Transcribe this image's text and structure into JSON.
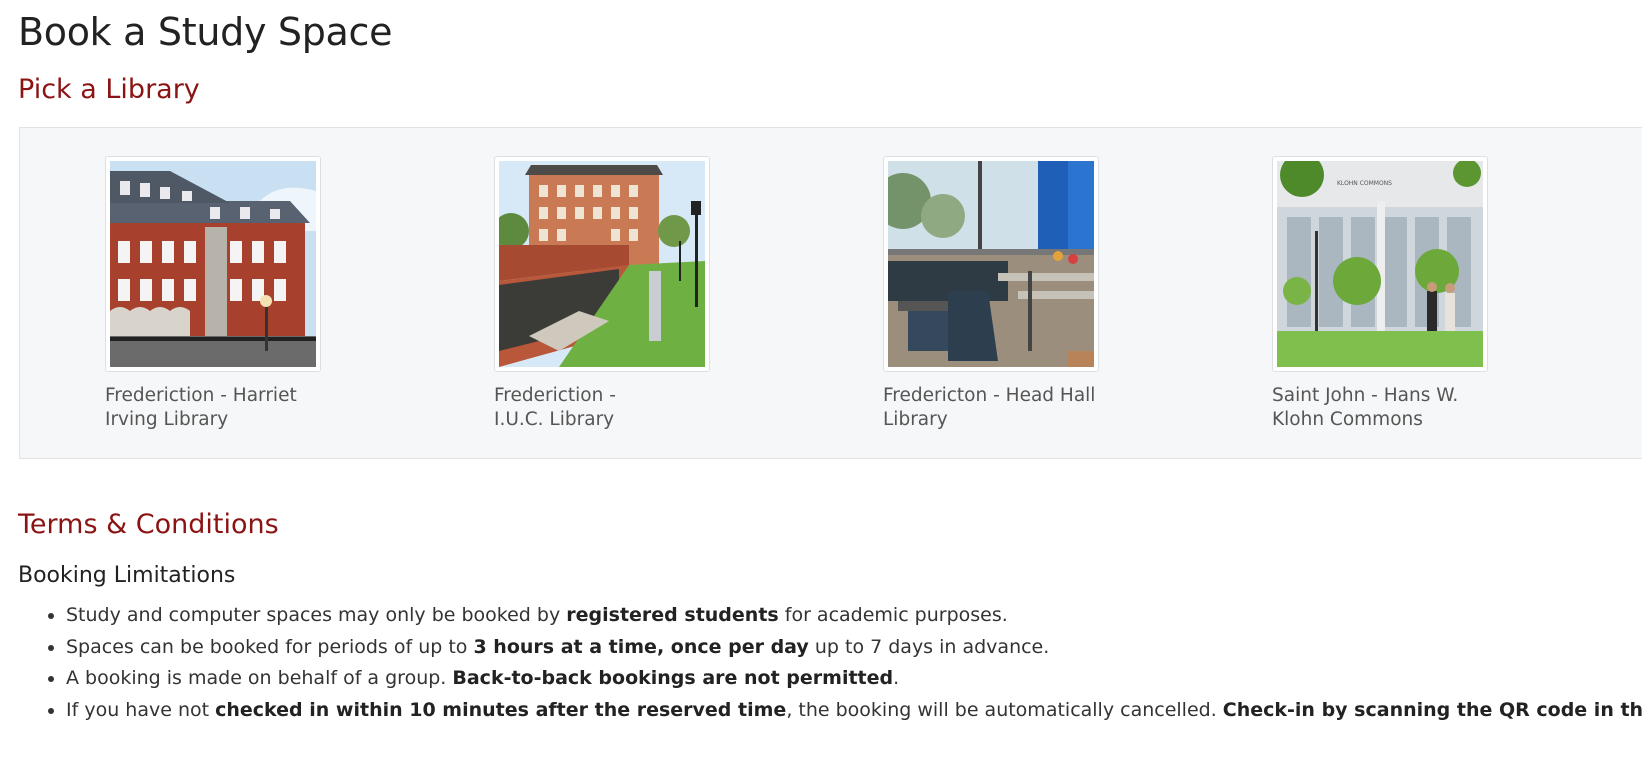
{
  "page": {
    "title": "Book a Study Space",
    "pick_heading": "Pick a Library",
    "terms_heading": "Terms & Conditions"
  },
  "libraries": [
    {
      "name": "Frederiction - Harriet Irving Library",
      "image": "harriet-irving-library-photo"
    },
    {
      "name": "Frederiction - I.U.C. Library",
      "image": "iuc-library-photo"
    },
    {
      "name": "Fredericton - Head Hall Library",
      "image": "head-hall-library-photo"
    },
    {
      "name": "Saint John - Hans W. Klohn Commons",
      "image": "klohn-commons-photo"
    }
  ],
  "terms": {
    "subheading": "Booking Limitations",
    "items": [
      {
        "p1": "Study and computer spaces may only be booked by ",
        "b1": "registered students",
        "p2": " for academic purposes."
      },
      {
        "p1": "Spaces can be booked for periods of up to ",
        "b1": "3 hours at a time, once per day",
        "p2": " up to 7 days in advance."
      },
      {
        "p1": "A booking is made on behalf of a group. ",
        "b1": "Back-to-back bookings are not permitted",
        "p2": "."
      },
      {
        "p1": "If you have not ",
        "b1": "checked in within 10 minutes after the reserved time",
        "p2": ", the booking will be automatically cancelled. ",
        "b2": "Check-in by scanning the QR code in the room"
      }
    ]
  },
  "colors": {
    "heading_accent": "#8a1414",
    "panel_bg": "#f6f7f8"
  }
}
